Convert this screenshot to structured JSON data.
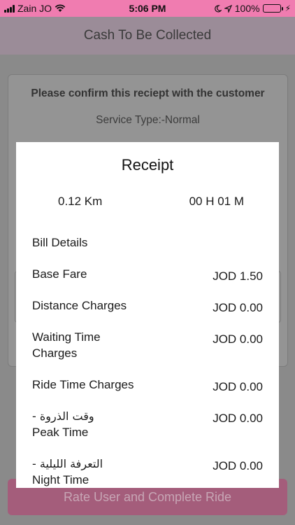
{
  "status_bar": {
    "carrier": "Zain JO",
    "time": "5:06 PM",
    "battery_pct": "100%",
    "battery_level": 1.0,
    "accent": "#f07cb0"
  },
  "nav": {
    "title": "Cash To Be Collected"
  },
  "background": {
    "confirm_text": "Please confirm this reciept with the customer",
    "service_type": "Service Type:-Normal"
  },
  "receipt": {
    "title": "Receipt",
    "distance": "0.12 Km",
    "duration": "00 H 01 M",
    "bill_header": "Bill Details",
    "rows": [
      {
        "label": "Base Fare",
        "value": "JOD 1.50"
      },
      {
        "label": "Distance Charges",
        "value": "JOD 0.00"
      },
      {
        "label_line1": "Waiting Time",
        "label_line2": "Charges",
        "value": "JOD 0.00"
      },
      {
        "label": "Ride Time Charges",
        "value": "JOD 0.00"
      },
      {
        "label_ar": "وقت الذروة -",
        "label_en": "Peak Time",
        "value": "JOD 0.00"
      },
      {
        "label_ar": "التعرفة الليلية -",
        "label_en": "Night Time",
        "value": "JOD 0.00"
      }
    ]
  },
  "action": {
    "complete_label": "Rate User and Complete Ride"
  }
}
